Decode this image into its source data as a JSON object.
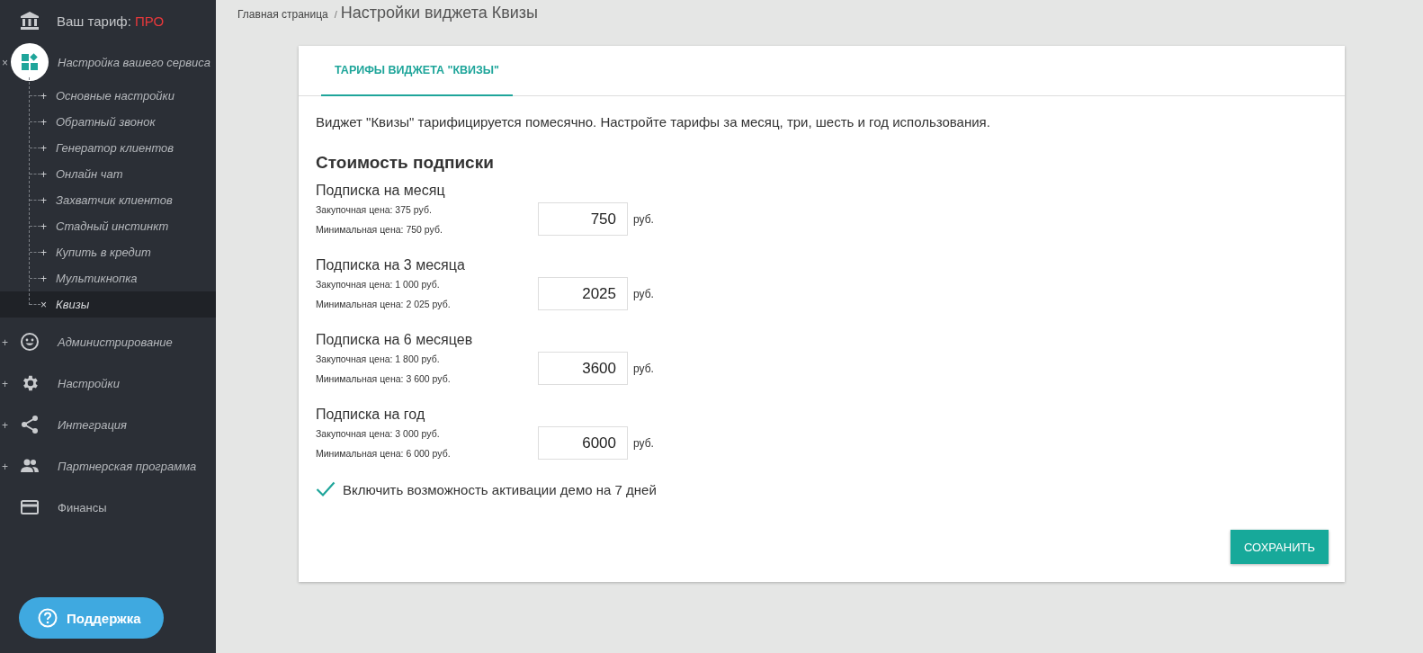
{
  "sidebar": {
    "plan": {
      "label": "Ваш тариф:",
      "value": "ПРО"
    },
    "sections": [
      {
        "toggle": "×",
        "label": "Настройка вашего сервиса",
        "children": [
          {
            "marker": "+",
            "label": "Основные настройки",
            "selected": false
          },
          {
            "marker": "+",
            "label": "Обратный звонок",
            "selected": false
          },
          {
            "marker": "+",
            "label": "Генератор клиентов",
            "selected": false
          },
          {
            "marker": "+",
            "label": "Онлайн чат",
            "selected": false
          },
          {
            "marker": "+",
            "label": "Захватчик клиентов",
            "selected": false
          },
          {
            "marker": "+",
            "label": "Стадный инстинкт",
            "selected": false
          },
          {
            "marker": "+",
            "label": "Купить в кредит",
            "selected": false
          },
          {
            "marker": "+",
            "label": "Мультикнопка",
            "selected": false
          },
          {
            "marker": "×",
            "label": "Квизы",
            "selected": true
          }
        ]
      },
      {
        "toggle": "+",
        "label": "Администрирование"
      },
      {
        "toggle": "+",
        "label": "Настройки"
      },
      {
        "toggle": "+",
        "label": "Интеграция"
      },
      {
        "toggle": "+",
        "label": "Партнерская программа"
      },
      {
        "label": "Финансы"
      }
    ],
    "support": "Поддержка"
  },
  "breadcrumb": {
    "home": "Главная страница",
    "separator": "/",
    "current": "Настройки виджета Квизы"
  },
  "tabs": [
    {
      "label": "ТАРИФЫ ВИДЖЕТА \"КВИЗЫ\"",
      "selected": true
    }
  ],
  "intro": "Виджет \"Квизы\" тарифицируется помесячно. Настройте тарифы за месяц, три, шесть и год использования.",
  "heading": "Стоимость подписки",
  "plans": [
    {
      "title": "Подписка на месяц",
      "purchase": "Закупочная цена: 375 руб.",
      "minimum": "Минимальная цена: 750 руб.",
      "value": "750",
      "unit": "руб."
    },
    {
      "title": "Подписка на 3 месяца",
      "purchase": "Закупочная цена: 1 000 руб.",
      "minimum": "Минимальная цена: 2 025 руб.",
      "value": "2025",
      "unit": "руб."
    },
    {
      "title": "Подписка на 6 месяцев",
      "purchase": "Закупочная цена: 1 800 руб.",
      "minimum": "Минимальная цена: 3 600 руб.",
      "value": "3600",
      "unit": "руб."
    },
    {
      "title": "Подписка на год",
      "purchase": "Закупочная цена: 3 000 руб.",
      "minimum": "Минимальная цена: 6 000 руб.",
      "value": "6000",
      "unit": "руб."
    }
  ],
  "demo": {
    "label": "Включить возможность активации демо на 7 дней",
    "checked": true
  },
  "save": "СОХРАНИТЬ"
}
